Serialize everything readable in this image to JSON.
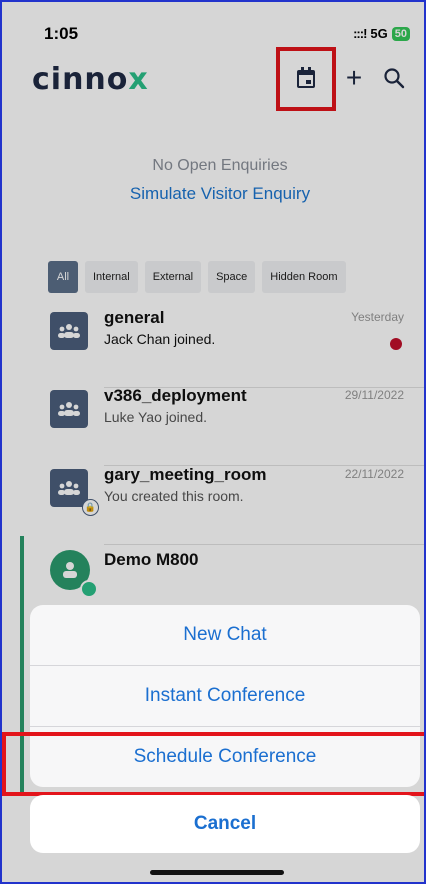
{
  "status": {
    "time": "1:05",
    "signal": ":::!",
    "network": "5G",
    "battery": "50"
  },
  "header": {
    "logo": "cinnox"
  },
  "empty_state": {
    "message": "No Open Enquiries",
    "link": "Simulate Visitor Enquiry"
  },
  "filters": [
    "All",
    "Internal",
    "External",
    "Space",
    "Hidden Room"
  ],
  "chats": [
    {
      "title": "general",
      "subtitle": "Jack Chan joined.",
      "time": "Yesterday"
    },
    {
      "title": "v386_deployment",
      "subtitle": "Luke Yao joined.",
      "time": "29/11/2022"
    },
    {
      "title": "gary_meeting_room",
      "subtitle": "You created this room.",
      "time": "22/11/2022"
    },
    {
      "title": "Demo M800",
      "subtitle": "",
      "time": ""
    }
  ],
  "action_sheet": {
    "options": [
      "New Chat",
      "Instant Conference",
      "Schedule Conference"
    ],
    "cancel": "Cancel"
  },
  "colors": {
    "accent": "#1b6fd0",
    "brand_green": "#2bbf8a",
    "highlight": "#e3141b",
    "avatar": "#4c5f7c"
  }
}
